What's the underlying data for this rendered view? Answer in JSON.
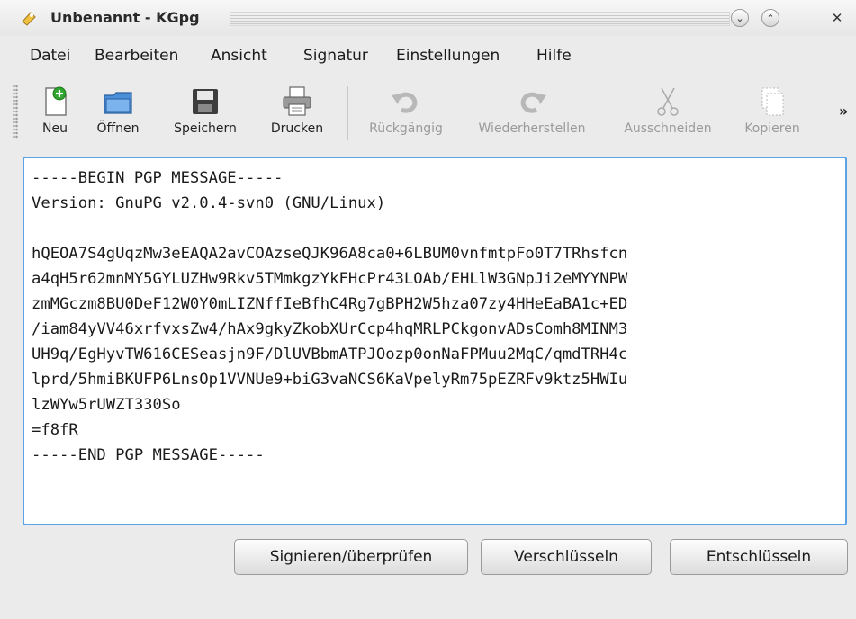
{
  "window": {
    "title": "Unbenannt - KGpg",
    "controls": [
      "minimize-icon",
      "maximize-icon",
      "close-icon"
    ]
  },
  "menu": {
    "items": [
      "Datei",
      "Bearbeiten",
      "Ansicht",
      "Signatur",
      "Einstellungen",
      "Hilfe"
    ]
  },
  "toolbar": {
    "buttons": [
      {
        "label": "Neu",
        "icon": "new-document-icon",
        "enabled": true
      },
      {
        "label": "Öffnen",
        "icon": "open-folder-icon",
        "enabled": true
      },
      {
        "label": "Speichern",
        "icon": "save-disk-icon",
        "enabled": true
      },
      {
        "label": "Drucken",
        "icon": "printer-icon",
        "enabled": true
      },
      {
        "label": "Rückgängig",
        "icon": "undo-icon",
        "enabled": false
      },
      {
        "label": "Wiederherstellen",
        "icon": "redo-icon",
        "enabled": false
      },
      {
        "label": "Ausschneiden",
        "icon": "scissors-icon",
        "enabled": false
      },
      {
        "label": "Kopieren",
        "icon": "copy-icon",
        "enabled": false
      }
    ],
    "overflow": "»"
  },
  "editor": {
    "content": "-----BEGIN PGP MESSAGE-----\nVersion: GnuPG v2.0.4-svn0 (GNU/Linux)\n\nhQEOA7S4gUqzMw3eEAQA2avCOAzseQJK96A8ca0+6LBUM0vnfmtpFo0T7TRhsfcn\na4qH5r62mnMY5GYLUZHw9Rkv5TMmkgzYkFHcPr43LOAb/EHLlW3GNpJi2eMYYNPW\nzmMGczm8BU0DeF12W0Y0mLIZNffIeBfhC4Rg7gBPH2W5hza07zy4HHeEaBA1c+ED\n/iam84yVV46xrfvxsZw4/hAx9gkyZkobXUrCcp4hqMRLPCkgonvADsComh8MINM3\nUH9q/EgHyvTW616CESeasjn9F/DlUVBbmATPJOozp0onNaFPMuu2MqC/qmdTRH4c\nlprd/5hmiBKUFP6LnsOp1VVNUe9+biG3vaNCS6KaVpelyRm75pEZRFv9ktz5HWIu\nlzWYw5rUWZT330So\n=f8fR\n-----END PGP MESSAGE-----"
  },
  "actions": {
    "sign": "Signieren/überprüfen",
    "encrypt": "Verschlüsseln",
    "decrypt": "Entschlüsseln"
  }
}
